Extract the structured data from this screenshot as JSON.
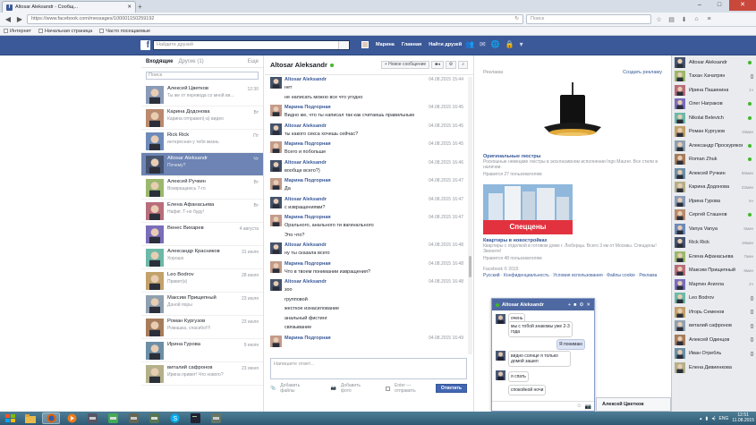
{
  "browser": {
    "tab_title": "Altosar Aleksandr - Сообщ...",
    "url": "https://www.facebook.com/messages/100001150259192",
    "search_placeholder": "Поиск",
    "bookmarks": [
      "Интернет",
      "Начальная страница",
      "Часто посещаемые"
    ]
  },
  "fb": {
    "search_placeholder": "Найдите друзей",
    "nav": [
      "Марина",
      "Главная",
      "Найти друзей"
    ]
  },
  "left": {
    "tab_inbox": "Входящие",
    "tab_other": "Другие (1)",
    "more": "Еще",
    "search_placeholder": "Поиск",
    "conversations": [
      {
        "name": "Алексей Цветков",
        "preview": "Ты же от перевода со мной ви...",
        "time": "12:30"
      },
      {
        "name": "Карина Додонова",
        "preview": "Карина отправил(-а) видео",
        "time": "Вт"
      },
      {
        "name": "Rick Rick",
        "preview": "интересная у тебя жизнь",
        "time": "Пт"
      },
      {
        "name": "Altosar Aleksandr",
        "preview": "Почему?",
        "time": "Чт"
      },
      {
        "name": "Алексей Ручкин",
        "preview": "Возвращаюсь 7-го",
        "time": "Вт"
      },
      {
        "name": "Елена Афанасьева",
        "preview": "Нафиг. Т-но буду!",
        "time": "Вт"
      },
      {
        "name": "Венес Вихарев",
        "preview": "",
        "time": "4 августа"
      },
      {
        "name": "Александр Красников",
        "preview": "Хорошо",
        "time": "31 июля"
      },
      {
        "name": "Leo Bodrov",
        "preview": "Привет(к)",
        "time": "28 июля"
      },
      {
        "name": "Максим Прищепный",
        "preview": "Доной поры",
        "time": "23 июля"
      },
      {
        "name": "Роман Кургузов",
        "preview": "Ромашка, спасибо!!!!",
        "time": "23 июля"
      },
      {
        "name": "Ирина Гурова",
        "preview": "",
        "time": "9 июля"
      },
      {
        "name": "виталий сафронов",
        "preview": "Ирина привет! Что нового?",
        "time": "23 июня"
      }
    ]
  },
  "thread": {
    "title": "Altosar Aleksandr",
    "new_message": "+ Новое сообщение",
    "messages": [
      {
        "author": "Altosar Aleksandr",
        "time": "04.08.2015 15:44",
        "lines": [
          "нет",
          "не написать можно все что угодно"
        ]
      },
      {
        "author": "Марина Подгорная",
        "time": "04.08.2015 16:45",
        "lines": [
          "Видно же, что ты написал так как считаешь правильным"
        ]
      },
      {
        "author": "Altosar Aleksandr",
        "time": "04.08.2015 16:45",
        "lines": [
          "ты какого секса хочешь сейчас?"
        ]
      },
      {
        "author": "Марина Подгорная",
        "time": "04.08.2015 16:45",
        "lines": [
          "Всего и побольше"
        ]
      },
      {
        "author": "Altosar Aleksandr",
        "time": "04.08.2015 16:46",
        "lines": [
          "вообще всего?)"
        ]
      },
      {
        "author": "Марина Подгорная",
        "time": "04.08.2015 16:47",
        "lines": [
          "Да"
        ]
      },
      {
        "author": "Altosar Aleksandr",
        "time": "04.08.2015 16:47",
        "lines": [
          "с извращениями?"
        ]
      },
      {
        "author": "Марина Подгорная",
        "time": "04.08.2015 16:47",
        "lines": [
          "Орального, анального ти вагинального",
          "Это что?"
        ]
      },
      {
        "author": "Altosar Aleksandr",
        "time": "04.08.2015 16:48",
        "lines": [
          "ну ты сказала всего"
        ]
      },
      {
        "author": "Марина Подгорная",
        "time": "04.08.2015 16:48",
        "lines": [
          "Что в твоем понимании извращения?"
        ]
      },
      {
        "author": "Altosar Aleksandr",
        "time": "04.08.2015 16:48",
        "lines": [
          "зоо",
          "групповой",
          "жесткое изнасилование",
          "анальный фистинг",
          "связывание"
        ]
      },
      {
        "author": "Марина Подгорная",
        "time": "04.08.2015 16:49",
        "lines": [
          ""
        ]
      }
    ],
    "compose_placeholder": "Напишите ответ...",
    "add_files": "Добавить файлы",
    "add_photo": "Добавить фото",
    "enter_hint": "Enter — отправить",
    "send": "Ответить"
  },
  "ads": {
    "header": "Реклама",
    "create_ad": "Создать рекламу",
    "ad1": {
      "title": "Оригинальные люстры",
      "desc": "Роскошные немецкие люстры в эксклюзивном исполнении Ingo Maurer. Все стили в наличии.",
      "likes": "Нравится 27 пользователям"
    },
    "ad2": {
      "banner": "Спеццены",
      "title": "Квартиры в новостройках",
      "desc": "Квартиры с отделкой в готовом доме г. Люберцы. Всего 3 км от Москвы. Спеццены! Звоните!",
      "likes": "Нравится 48 пользователям"
    },
    "footer_copy": "Facebook © 2015",
    "footer_links": [
      "Русский",
      "Конфиденциальность",
      "Условия использования",
      "Файлы cookie",
      "Реклама"
    ]
  },
  "chatpopup": {
    "title": "Altosar Aleksandr",
    "bubbles": [
      "очень",
      "мы с тобой знакомы уже 2-3 года",
      "Я понимаю",
      "видно солнце я только домой зашел",
      "я спать",
      "спокойной ночи"
    ]
  },
  "chat": {
    "bar_name": "Алексей Цветков",
    "friends": [
      {
        "name": "Altosar Aleksandr",
        "status": ""
      },
      {
        "name": "Тахан Хачатрян",
        "status": ""
      },
      {
        "name": "Ирина Пашинина",
        "status": "1ч"
      },
      {
        "name": "Олег Награков",
        "status": ""
      },
      {
        "name": "Nikolai Belevich",
        "status": ""
      },
      {
        "name": "Роман Кургузов",
        "status": "19мин"
      },
      {
        "name": "Александр Проскуряков",
        "status": ""
      },
      {
        "name": "Roman Zhuk",
        "status": ""
      },
      {
        "name": "Алексей Ручкин",
        "status": "56мин"
      },
      {
        "name": "Карина Додонова",
        "status": "22мин"
      },
      {
        "name": "Ирина Гурова",
        "status": "6ч"
      },
      {
        "name": "Сергей Сташнов",
        "status": "1ч"
      },
      {
        "name": "Vanya Vanya",
        "status": "6мин"
      },
      {
        "name": "Rick Rick",
        "status": "18мин"
      },
      {
        "name": "Елена Афанасьева",
        "status": "7мин"
      },
      {
        "name": "Максим Прищепный",
        "status": "8мин"
      },
      {
        "name": "Мартин Агилла",
        "status": "2ч"
      },
      {
        "name": "Leo Bodrov",
        "status": ""
      },
      {
        "name": "Игорь Семенов",
        "status": ""
      },
      {
        "name": "виталий сафронов",
        "status": ""
      },
      {
        "name": "Алексей Одинцов",
        "status": ""
      },
      {
        "name": "Иван Отребль",
        "status": ""
      },
      {
        "name": "Елена Дивиенкова",
        "status": ""
      }
    ]
  },
  "taskbar": {
    "lang": "ENG",
    "time": "12:51",
    "date": "11.08.2015"
  },
  "colors": {
    "fb_blue": "#3b5998",
    "selected": "#6d84b4",
    "online": "#42b72a",
    "taskbar": "#2f5a73"
  }
}
